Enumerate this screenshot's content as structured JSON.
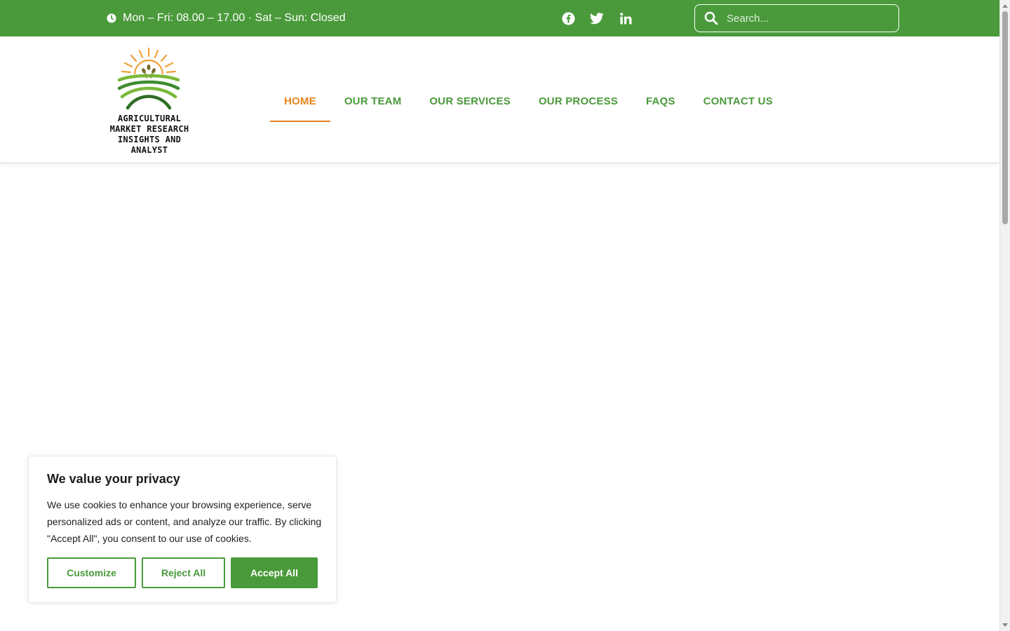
{
  "topbar": {
    "hours": "Mon – Fri: 08.00 – 17.00 · Sat – Sun: Closed",
    "social": [
      {
        "name": "facebook-icon"
      },
      {
        "name": "twitter-icon"
      },
      {
        "name": "linkedin-icon"
      }
    ],
    "search": {
      "placeholder": "Search...",
      "value": ""
    }
  },
  "logo": {
    "text": "AGRICULTURAL\nMARKET RESEARCH\nINSIGHTS AND\nANALYST"
  },
  "nav": {
    "items": [
      {
        "label": "HOME",
        "active": true
      },
      {
        "label": "OUR TEAM"
      },
      {
        "label": "OUR SERVICES"
      },
      {
        "label": "OUR PROCESS"
      },
      {
        "label": "FAQS"
      },
      {
        "label": "CONTACT US"
      }
    ]
  },
  "cookie": {
    "title": "We value your privacy",
    "text": "We use cookies to enhance your browsing experience, serve personalized ads or content, and analyze our traffic. By clicking \"Accept All\", you consent to our use of cookies.",
    "customize_label": "Customize",
    "reject_label": "Reject All",
    "accept_label": "Accept All"
  },
  "colors": {
    "brand_green": "#4a9a3b",
    "accent_orange": "#e8841a"
  }
}
